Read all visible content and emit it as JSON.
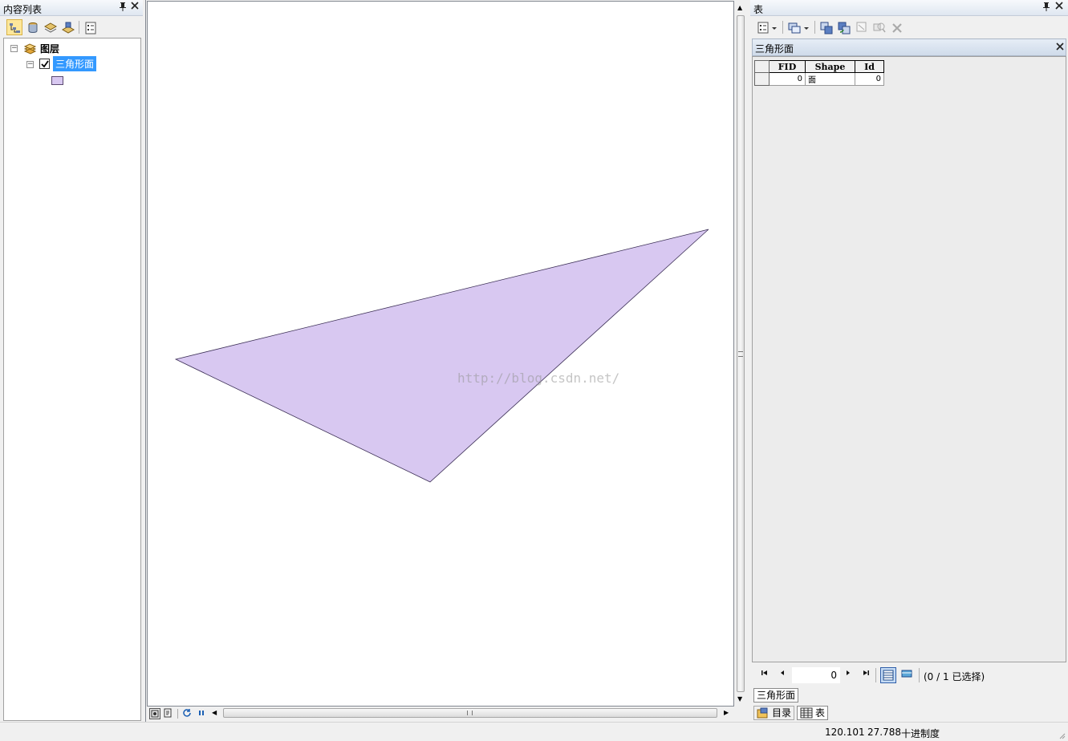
{
  "toc": {
    "title": "内容列表",
    "pin_glyph": "📌",
    "close_glyph": "✕",
    "toolbar": [
      {
        "name": "list-by-drawing-order-icon",
        "active": true
      },
      {
        "name": "list-by-source-icon",
        "active": false
      },
      {
        "name": "list-by-visibility-icon",
        "active": false
      },
      {
        "name": "list-by-selection-icon",
        "active": false
      },
      {
        "name": "options-icon",
        "active": false
      }
    ],
    "group_label": "图层",
    "layer": {
      "label": "三角形面",
      "checked": true,
      "fill_color": "#d8c8f1",
      "outline_color": "#5b4a70"
    }
  },
  "map": {
    "polygon": {
      "fill": "#d8c8f1",
      "stroke": "#3b2e55"
    },
    "watermark": "http://blog.csdn.net/"
  },
  "table": {
    "title": "表",
    "layer_tab_title": "三角形面",
    "columns": [
      "FID",
      "Shape",
      "Id"
    ],
    "rows": [
      [
        "0",
        "面",
        "0"
      ]
    ],
    "record_value": "0",
    "selection_text": "(0 / 1 已选择)",
    "layer_tab_label": "三角形面",
    "bottom_tabs": [
      {
        "label": "目录"
      },
      {
        "label": "表"
      }
    ]
  },
  "status": {
    "x": "120.101",
    "y": "27.788",
    "units": "十进制度"
  }
}
